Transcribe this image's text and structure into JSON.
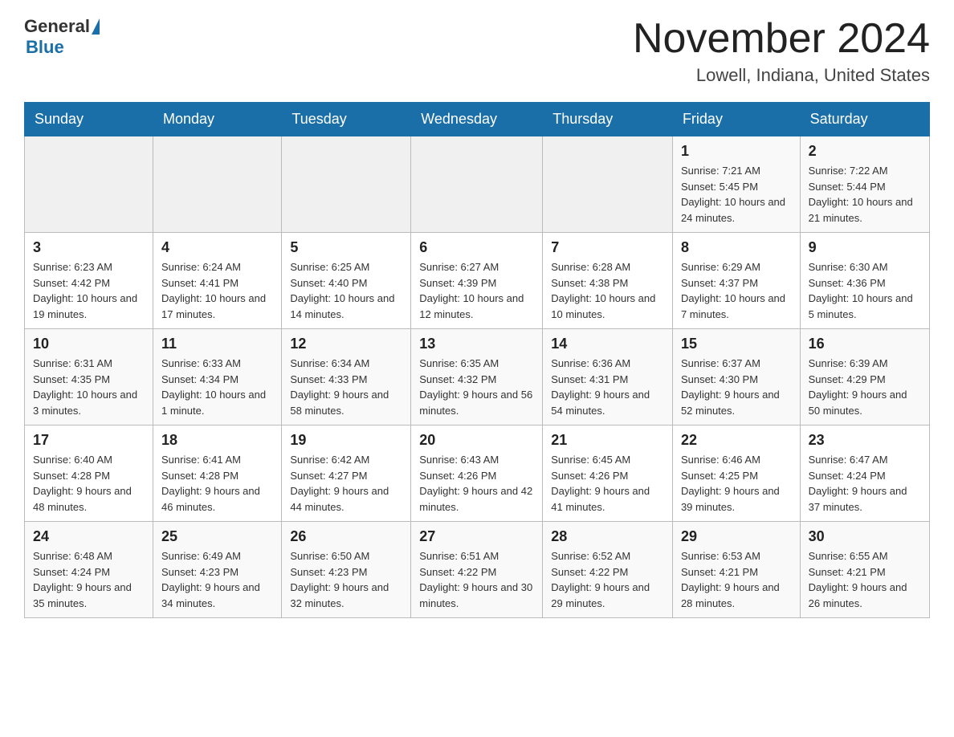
{
  "header": {
    "logo_general": "General",
    "logo_blue": "Blue",
    "month_title": "November 2024",
    "location": "Lowell, Indiana, United States"
  },
  "days_of_week": [
    "Sunday",
    "Monday",
    "Tuesday",
    "Wednesday",
    "Thursday",
    "Friday",
    "Saturday"
  ],
  "weeks": [
    [
      {
        "day": "",
        "info": ""
      },
      {
        "day": "",
        "info": ""
      },
      {
        "day": "",
        "info": ""
      },
      {
        "day": "",
        "info": ""
      },
      {
        "day": "",
        "info": ""
      },
      {
        "day": "1",
        "info": "Sunrise: 7:21 AM\nSunset: 5:45 PM\nDaylight: 10 hours and 24 minutes."
      },
      {
        "day": "2",
        "info": "Sunrise: 7:22 AM\nSunset: 5:44 PM\nDaylight: 10 hours and 21 minutes."
      }
    ],
    [
      {
        "day": "3",
        "info": "Sunrise: 6:23 AM\nSunset: 4:42 PM\nDaylight: 10 hours and 19 minutes."
      },
      {
        "day": "4",
        "info": "Sunrise: 6:24 AM\nSunset: 4:41 PM\nDaylight: 10 hours and 17 minutes."
      },
      {
        "day": "5",
        "info": "Sunrise: 6:25 AM\nSunset: 4:40 PM\nDaylight: 10 hours and 14 minutes."
      },
      {
        "day": "6",
        "info": "Sunrise: 6:27 AM\nSunset: 4:39 PM\nDaylight: 10 hours and 12 minutes."
      },
      {
        "day": "7",
        "info": "Sunrise: 6:28 AM\nSunset: 4:38 PM\nDaylight: 10 hours and 10 minutes."
      },
      {
        "day": "8",
        "info": "Sunrise: 6:29 AM\nSunset: 4:37 PM\nDaylight: 10 hours and 7 minutes."
      },
      {
        "day": "9",
        "info": "Sunrise: 6:30 AM\nSunset: 4:36 PM\nDaylight: 10 hours and 5 minutes."
      }
    ],
    [
      {
        "day": "10",
        "info": "Sunrise: 6:31 AM\nSunset: 4:35 PM\nDaylight: 10 hours and 3 minutes."
      },
      {
        "day": "11",
        "info": "Sunrise: 6:33 AM\nSunset: 4:34 PM\nDaylight: 10 hours and 1 minute."
      },
      {
        "day": "12",
        "info": "Sunrise: 6:34 AM\nSunset: 4:33 PM\nDaylight: 9 hours and 58 minutes."
      },
      {
        "day": "13",
        "info": "Sunrise: 6:35 AM\nSunset: 4:32 PM\nDaylight: 9 hours and 56 minutes."
      },
      {
        "day": "14",
        "info": "Sunrise: 6:36 AM\nSunset: 4:31 PM\nDaylight: 9 hours and 54 minutes."
      },
      {
        "day": "15",
        "info": "Sunrise: 6:37 AM\nSunset: 4:30 PM\nDaylight: 9 hours and 52 minutes."
      },
      {
        "day": "16",
        "info": "Sunrise: 6:39 AM\nSunset: 4:29 PM\nDaylight: 9 hours and 50 minutes."
      }
    ],
    [
      {
        "day": "17",
        "info": "Sunrise: 6:40 AM\nSunset: 4:28 PM\nDaylight: 9 hours and 48 minutes."
      },
      {
        "day": "18",
        "info": "Sunrise: 6:41 AM\nSunset: 4:28 PM\nDaylight: 9 hours and 46 minutes."
      },
      {
        "day": "19",
        "info": "Sunrise: 6:42 AM\nSunset: 4:27 PM\nDaylight: 9 hours and 44 minutes."
      },
      {
        "day": "20",
        "info": "Sunrise: 6:43 AM\nSunset: 4:26 PM\nDaylight: 9 hours and 42 minutes."
      },
      {
        "day": "21",
        "info": "Sunrise: 6:45 AM\nSunset: 4:26 PM\nDaylight: 9 hours and 41 minutes."
      },
      {
        "day": "22",
        "info": "Sunrise: 6:46 AM\nSunset: 4:25 PM\nDaylight: 9 hours and 39 minutes."
      },
      {
        "day": "23",
        "info": "Sunrise: 6:47 AM\nSunset: 4:24 PM\nDaylight: 9 hours and 37 minutes."
      }
    ],
    [
      {
        "day": "24",
        "info": "Sunrise: 6:48 AM\nSunset: 4:24 PM\nDaylight: 9 hours and 35 minutes."
      },
      {
        "day": "25",
        "info": "Sunrise: 6:49 AM\nSunset: 4:23 PM\nDaylight: 9 hours and 34 minutes."
      },
      {
        "day": "26",
        "info": "Sunrise: 6:50 AM\nSunset: 4:23 PM\nDaylight: 9 hours and 32 minutes."
      },
      {
        "day": "27",
        "info": "Sunrise: 6:51 AM\nSunset: 4:22 PM\nDaylight: 9 hours and 30 minutes."
      },
      {
        "day": "28",
        "info": "Sunrise: 6:52 AM\nSunset: 4:22 PM\nDaylight: 9 hours and 29 minutes."
      },
      {
        "day": "29",
        "info": "Sunrise: 6:53 AM\nSunset: 4:21 PM\nDaylight: 9 hours and 28 minutes."
      },
      {
        "day": "30",
        "info": "Sunrise: 6:55 AM\nSunset: 4:21 PM\nDaylight: 9 hours and 26 minutes."
      }
    ]
  ]
}
